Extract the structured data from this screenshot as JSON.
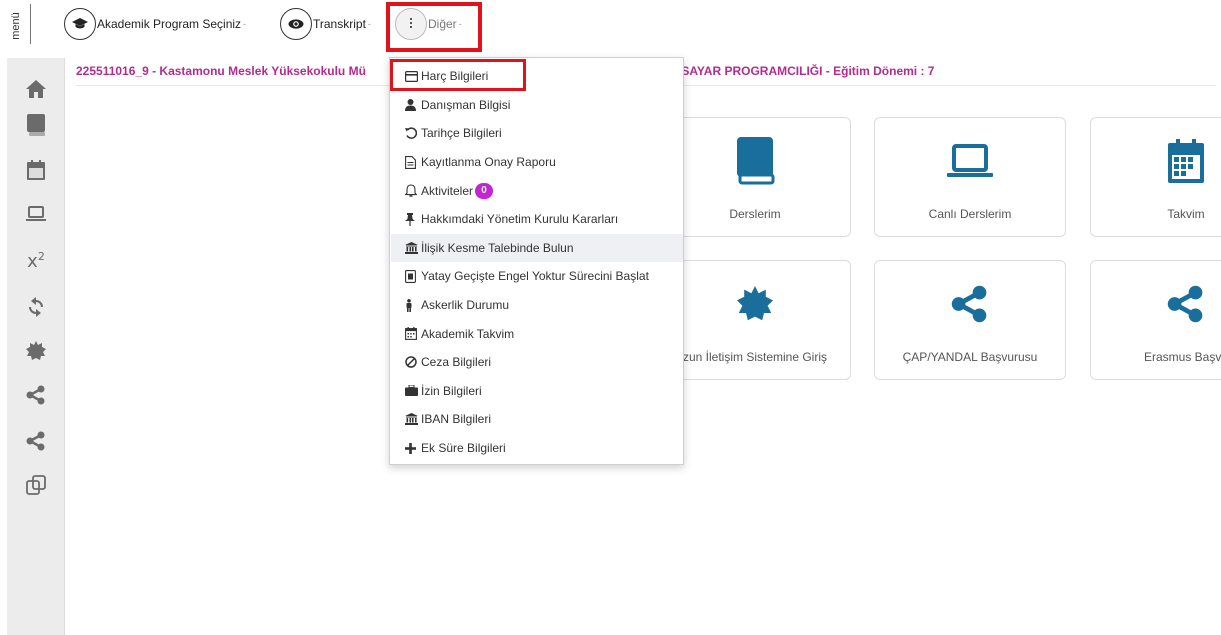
{
  "topbar": {
    "menu_text": "menü",
    "buttons": [
      {
        "label": "Akademik Program Seçiniz",
        "icon": "graduation-cap-icon"
      },
      {
        "label": "Transkript",
        "icon": "eye-icon"
      },
      {
        "label": "Diğer",
        "icon": "vertical-ellipsis-icon"
      }
    ]
  },
  "info_line": {
    "left": "225511016_9 - Kastamonu Meslek Yüksekokulu Mü",
    "right": "İSAYAR PROGRAMCILIĞI - Eğitim Dönemi : 7"
  },
  "sidebar": {
    "icons": [
      "home-icon",
      "book-icon",
      "calendar-icon",
      "laptop-icon",
      "superscript-icon",
      "refresh-icon",
      "certificate-icon",
      "share-icon",
      "share-icon",
      "copy-icon"
    ]
  },
  "tiles": [
    {
      "label": "Derslerim",
      "icon": "book-icon"
    },
    {
      "label": "Canlı Derslerim",
      "icon": "laptop-icon"
    },
    {
      "label": "Takvim",
      "icon": "calendar-icon"
    },
    {
      "label": "zun İletişim Sistemine Giriş",
      "icon": "certificate-icon"
    },
    {
      "label": "ÇAP/YANDAL Başvurusu",
      "icon": "share-icon"
    },
    {
      "label": "Erasmus Başvu",
      "icon": "share-icon"
    }
  ],
  "dropdown": {
    "items": [
      {
        "label": "Harç Bilgileri",
        "icon": "credit-card-icon"
      },
      {
        "label": "Danışman Bilgisi",
        "icon": "user-icon"
      },
      {
        "label": "Tarihçe Bilgileri",
        "icon": "history-icon"
      },
      {
        "label": "Kayıtlanma Onay Raporu",
        "icon": "file-text-icon"
      },
      {
        "label": "Aktiviteler",
        "icon": "bell-icon",
        "badge": "0"
      },
      {
        "label": "Hakkımdaki Yönetim Kurulu Kararları",
        "icon": "thumbtack-icon"
      },
      {
        "label": "İlişik Kesme Talebinde Bulun",
        "icon": "institution-icon"
      },
      {
        "label": "Yatay Geçişte Engel Yoktur Sürecini Başlat",
        "icon": "document-icon"
      },
      {
        "label": "Askerlik Durumu",
        "icon": "person-icon"
      },
      {
        "label": "Akademik Takvim",
        "icon": "calendar-icon"
      },
      {
        "label": "Ceza Bilgileri",
        "icon": "ban-icon"
      },
      {
        "label": "İzin Bilgileri",
        "icon": "suitcase-icon"
      },
      {
        "label": "IBAN Bilgileri",
        "icon": "institution-icon"
      },
      {
        "label": "Ek Süre Bilgileri",
        "icon": "plus-icon"
      }
    ]
  },
  "colors": {
    "info_text": "#b52a92",
    "tile_icon": "#1a6e9c",
    "highlight": "#e0131a",
    "badge": "#c524d3",
    "sidebar_bg": "#ececec"
  }
}
